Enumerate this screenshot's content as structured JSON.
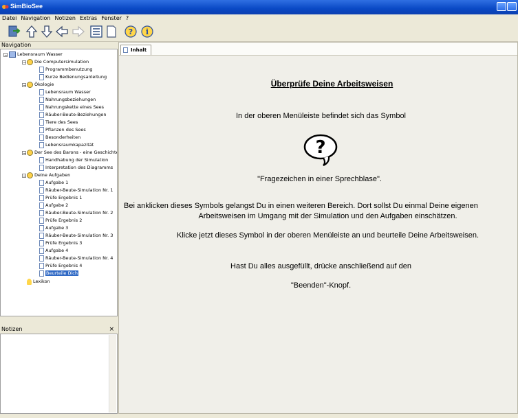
{
  "window": {
    "title": "SimBioSee"
  },
  "menu": [
    "Datei",
    "Navigation",
    "Notizen",
    "Extras",
    "Fenster",
    "?"
  ],
  "toolbar_icons": [
    "exit-icon",
    "arrow-up-icon",
    "arrow-down-icon",
    "arrow-left-icon",
    "arrow-right-icon",
    "list-icon",
    "page-icon",
    "help-bubble-icon",
    "info-icon"
  ],
  "navigation": {
    "title": "Navigation",
    "items": [
      {
        "label": "Lebensraum Wasser"
      },
      {
        "label": "Die Computersimulation"
      },
      {
        "label": "Programmbenutzung"
      },
      {
        "label": "Kurze Bedienungsanleitung"
      },
      {
        "label": "Ökologie"
      },
      {
        "label": "Lebensraum Wasser"
      },
      {
        "label": "Nahrungsbeziehungen"
      },
      {
        "label": "Nahrungskette eines Sees"
      },
      {
        "label": "Räuber-Beute-Beziehungen"
      },
      {
        "label": "Tiere des Sees"
      },
      {
        "label": "Pflanzen des Sees"
      },
      {
        "label": "Besonderheiten"
      },
      {
        "label": "Lebensraumkapazität"
      },
      {
        "label": "Der See des Barons - eine Geschichte"
      },
      {
        "label": "Handhabung der Simulation"
      },
      {
        "label": "Interpretation des Diagramms"
      },
      {
        "label": "Deine Aufgaben"
      },
      {
        "label": "Aufgabe 1"
      },
      {
        "label": "Räuber-Beute-Simulation Nr. 1"
      },
      {
        "label": "Prüfe Ergebnis 1"
      },
      {
        "label": "Aufgabe 2"
      },
      {
        "label": "Räuber-Beute-Simulation Nr. 2"
      },
      {
        "label": "Prüfe Ergebnis 2"
      },
      {
        "label": "Aufgabe 3"
      },
      {
        "label": "Räuber-Beute-Simulation Nr. 3"
      },
      {
        "label": "Prüfe Ergebnis 3"
      },
      {
        "label": "Aufgabe 4"
      },
      {
        "label": "Räuber-Beute-Simulation Nr. 4"
      },
      {
        "label": "Prüfe Ergebnis 4"
      },
      {
        "label": "Beurteile Dich"
      },
      {
        "label": "Lexikon"
      }
    ]
  },
  "notes": {
    "title": "Notizen",
    "close": "×"
  },
  "tab": {
    "label": "Inhalt"
  },
  "content": {
    "heading": "Überprüfe Deine Arbeitsweisen",
    "line1": "In der oberen Menüleiste befindet sich das Symbol",
    "symbol_glyph": "?",
    "line2": "\"Fragezeichen in einer Sprechblase\".",
    "line3": "Bei anklicken dieses Symbols gelangst Du in einen weiteren Bereich. Dort sollst Du einmal Deine eigenen",
    "line4": "Arbeitsweisen im Umgang mit der Simulation und den Aufgaben einschätzen.",
    "line5": "Klicke jetzt dieses Symbol in der oberen Menüleiste an und beurteile Deine Arbeitsweisen.",
    "line6": "Hast Du alles ausgefüllt, drücke anschließend auf den",
    "line7": "\"Beenden\"-Knopf."
  }
}
